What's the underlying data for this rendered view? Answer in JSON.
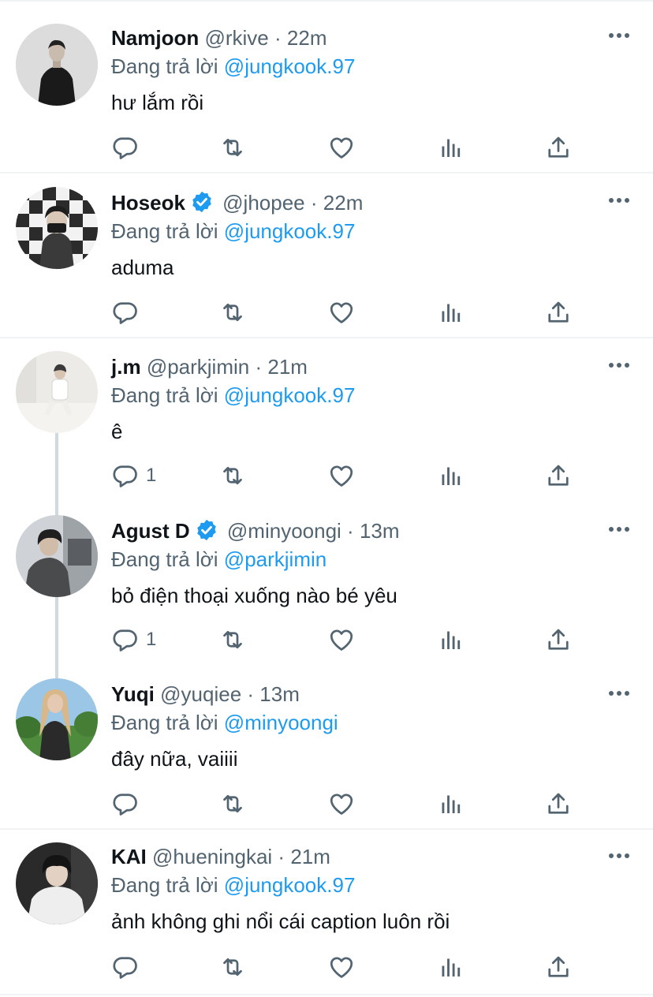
{
  "reply_prefix": "Đang trả lời",
  "colors": {
    "accent": "#1d9bf0",
    "secondary_text": "#536471",
    "divider": "#eff3f4",
    "thread_line": "#cfd9de"
  },
  "tweets": [
    {
      "name": "Namjoon",
      "handle": "@rkive",
      "time": "22m",
      "verified": false,
      "reply_to": "@jungkook.97",
      "text": "hư lắm rồi",
      "reply_count": ""
    },
    {
      "name": "Hoseok",
      "handle": "@jhopee",
      "time": "22m",
      "verified": true,
      "reply_to": "@jungkook.97",
      "text": "aduma",
      "reply_count": ""
    },
    {
      "name": "j.m",
      "handle": "@parkjimin",
      "time": "21m",
      "verified": false,
      "reply_to": "@jungkook.97",
      "text": "ê",
      "reply_count": "1"
    },
    {
      "name": "Agust D",
      "handle": "@minyoongi",
      "time": "13m",
      "verified": true,
      "reply_to": "@parkjimin",
      "text": "bỏ điện thoại xuống nào bé yêu",
      "reply_count": "1"
    },
    {
      "name": "Yuqi",
      "handle": "@yuqiee",
      "time": "13m",
      "verified": false,
      "reply_to": "@minyoongi",
      "text": "đây nữa, vaiiii",
      "reply_count": ""
    },
    {
      "name": "KAI",
      "handle": "@hueningkai",
      "time": "21m",
      "verified": false,
      "reply_to": "@jungkook.97",
      "text": "ảnh không ghi nổi cái caption luôn rồi",
      "reply_count": ""
    }
  ],
  "icons": [
    "reply-icon",
    "retweet-icon",
    "like-icon",
    "views-icon",
    "share-icon",
    "more-icon",
    "verified-badge-icon"
  ]
}
